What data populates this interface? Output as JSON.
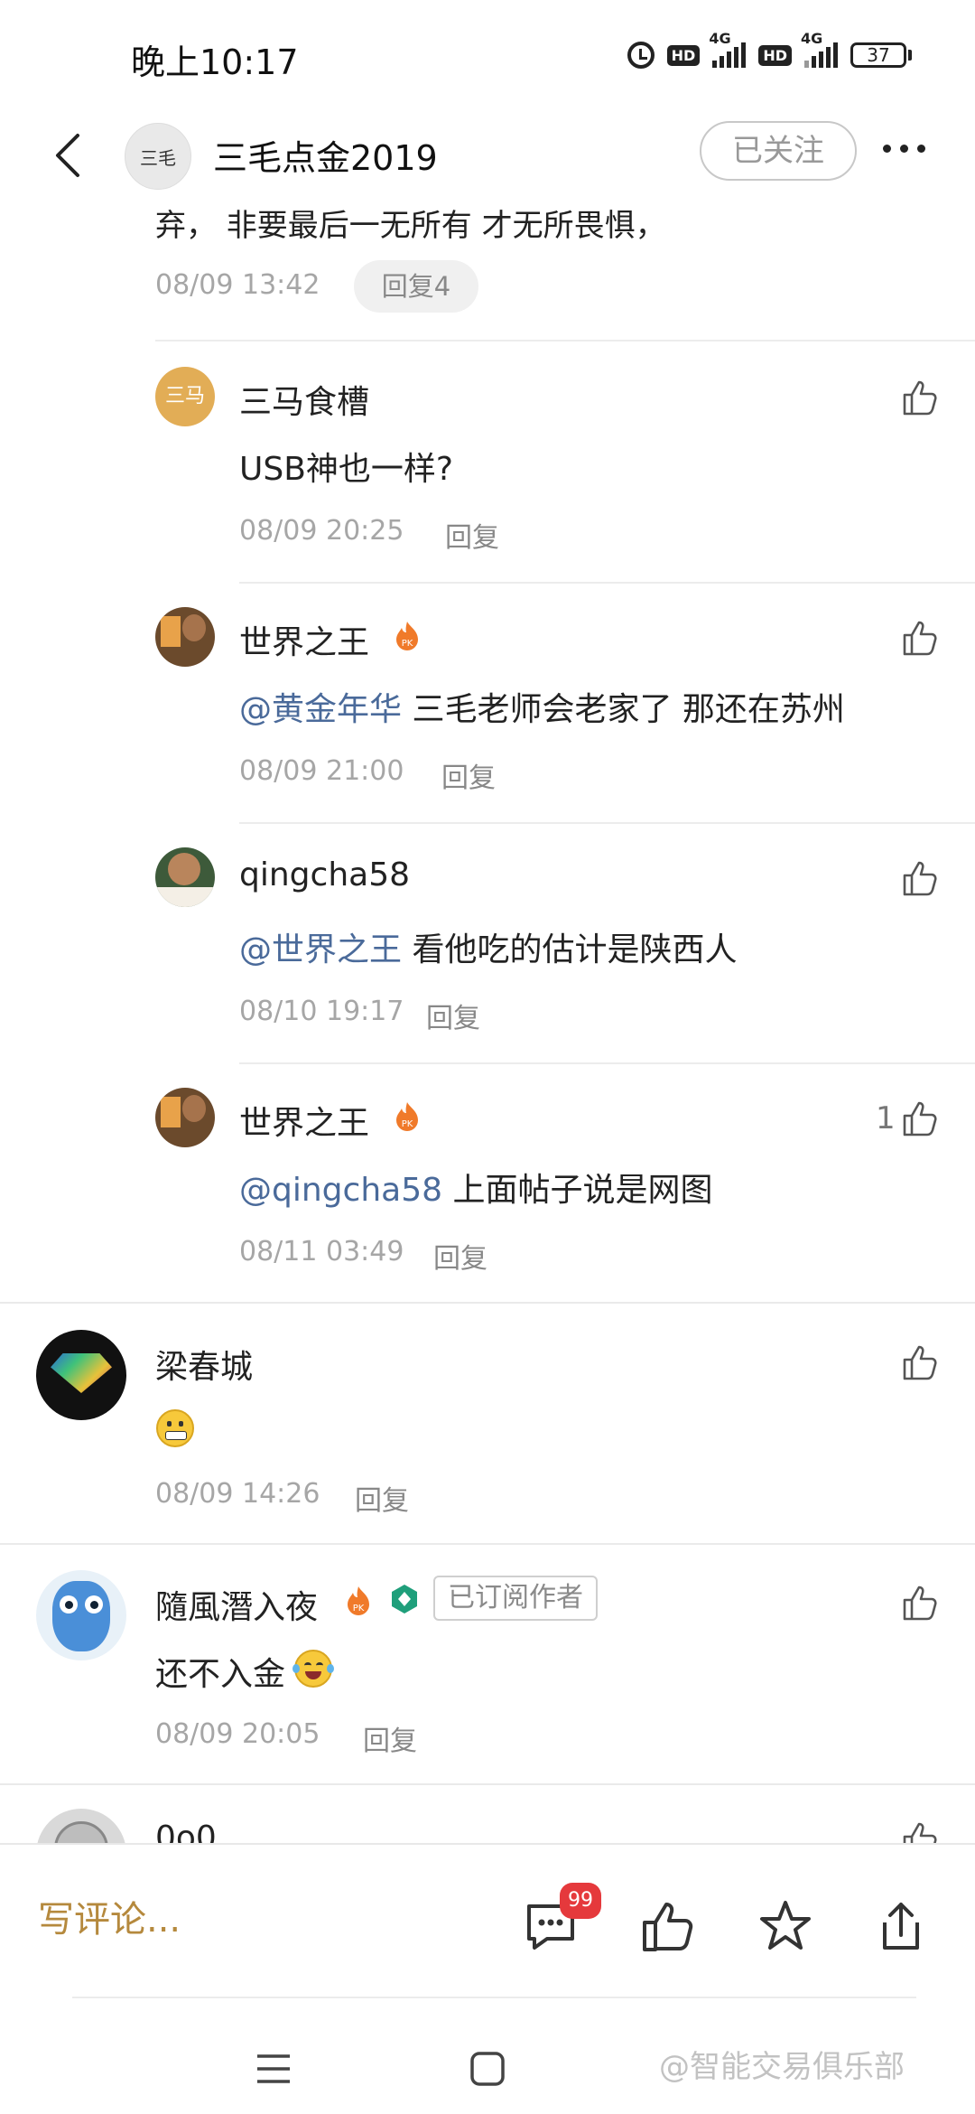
{
  "status_bar": {
    "time": "晚上10:17",
    "battery": "37",
    "net1": "4G",
    "net2": "4G",
    "hd": "HD"
  },
  "header": {
    "title": "三毛点金2019",
    "follow_label": "已关注",
    "avatar_text": "三毛"
  },
  "parent_comment": {
    "cut_text": "弃， 非要最后一无所有 才无所畏惧，",
    "time": "08/09 13:42",
    "reply_label": "回复4"
  },
  "replies": [
    {
      "name": "三马食槽",
      "avatar_text": "三马",
      "text": "USB神也一样?",
      "mention": "",
      "time": "08/09 20:25",
      "reply": "回复",
      "likes": ""
    },
    {
      "name": "世界之王",
      "mention": "@黄金年华",
      "text": " 三毛老师会老家了 那还在苏州",
      "time": "08/09 21:00",
      "reply": "回复",
      "likes": ""
    },
    {
      "name": "qingcha58",
      "mention": "@世界之王",
      "text": " 看他吃的估计是陕西人",
      "time": "08/10 19:17",
      "reply": "回复",
      "likes": ""
    },
    {
      "name": "世界之王",
      "mention": "@qingcha58",
      "text": " 上面帖子说是网图",
      "time": "08/11 03:49",
      "reply": "回复",
      "likes": "1"
    }
  ],
  "comments": [
    {
      "name": "梁春城",
      "text": "",
      "time": "08/09 14:26",
      "reply": "回复"
    },
    {
      "name": "隨風潛入夜",
      "text": "还不入金",
      "badge": "已订阅作者",
      "time": "08/09 20:05",
      "reply": "回复"
    },
    {
      "name": "0o0"
    }
  ],
  "bottom_bar": {
    "write_placeholder": "写评论...",
    "comment_count": "99"
  },
  "watermark": "@智能交易俱乐部"
}
